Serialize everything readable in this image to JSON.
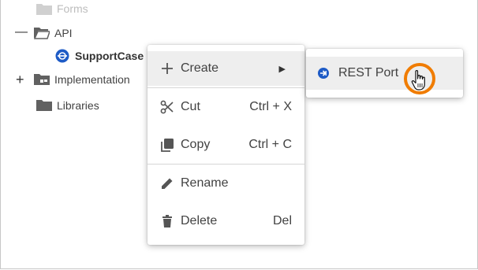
{
  "tree": {
    "forms_label": "Forms",
    "api_label": "API",
    "supportcase_label": "SupportCase",
    "implementation_label": "Implementation",
    "libraries_label": "Libraries",
    "expanded_symbol": "—",
    "collapsed_symbol": "+"
  },
  "context_menu": {
    "create": {
      "label": "Create",
      "icon": "plus-icon",
      "has_submenu": true
    },
    "cut": {
      "label": "Cut",
      "shortcut": "Ctrl + X",
      "icon": "scissors-icon"
    },
    "copy": {
      "label": "Copy",
      "shortcut": "Ctrl + C",
      "icon": "copy-icon"
    },
    "rename": {
      "label": "Rename",
      "icon": "pencil-icon"
    },
    "delete": {
      "label": "Delete",
      "shortcut": "Del",
      "icon": "trash-icon"
    }
  },
  "submenu": {
    "rest_port": {
      "label": "REST Port",
      "icon": "rest-port-icon"
    }
  },
  "colors": {
    "accent_blue": "#1e5bc6",
    "highlight_ring": "#f07c00",
    "hover_bg": "#eeeeee",
    "folder": "#616161"
  }
}
